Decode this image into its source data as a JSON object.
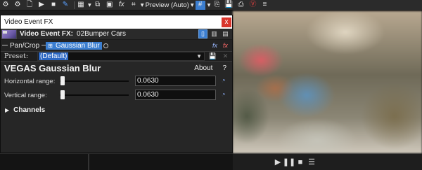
{
  "toolbar": {
    "preview_mode": "Preview (Auto)"
  },
  "fx_window": {
    "title": "Video Event FX",
    "close_glyph": "x",
    "header_label": "Video Event FX:",
    "media_name": "02Bumper Cars",
    "chain": {
      "items": [
        {
          "label": "Pan/Crop",
          "selected": false
        },
        {
          "label": "Gaussian Blur",
          "selected": true
        }
      ]
    },
    "preset": {
      "label": "Preset:",
      "value": "(Default)"
    },
    "plugin": {
      "name": "VEGAS Gaussian Blur",
      "about_label": "About",
      "help_label": "?"
    },
    "params": [
      {
        "label": "Horizontal range:",
        "value": "0.0630",
        "slider_fraction": 0.063
      },
      {
        "label": "Vertical range:",
        "value": "0.0630",
        "slider_fraction": 0.063
      }
    ],
    "channels_label": "Channels"
  },
  "colors": {
    "accent": "#3b7ed0",
    "close_red": "#d9342b",
    "window_bg": "#262626"
  },
  "icons": {
    "toolbar": [
      "gear-icon",
      "gear-small-icon",
      "delete-file-icon",
      "play-icon",
      "stop-icon",
      "paint-icon",
      "grid-dropdown-icon",
      "clip-icon",
      "window-icon",
      "fx-icon",
      "crop-icon",
      "grid-overlay-icon",
      "copy-icon",
      "save-icon",
      "snapshot-icon",
      "vegas-icon"
    ],
    "preview_controls": [
      "play-icon",
      "pause-icon",
      "stop-icon",
      "menu-icon"
    ]
  }
}
